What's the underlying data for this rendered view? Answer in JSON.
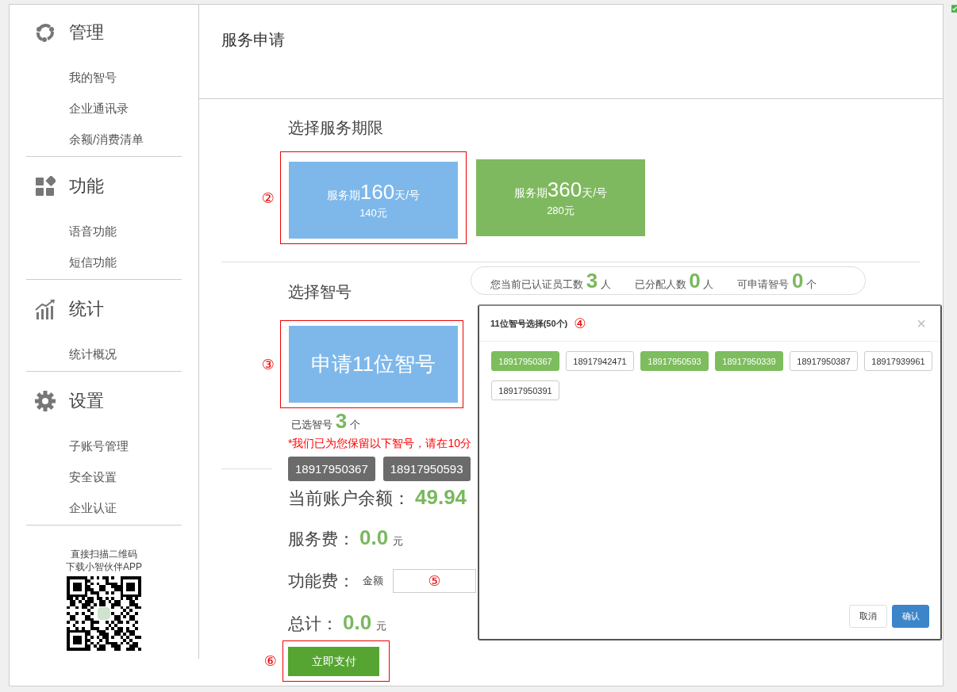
{
  "sidebar": {
    "groups": [
      {
        "kind": "cycle",
        "title": "管理",
        "items": [
          "我的智号",
          "企业通讯录",
          "余额/消费清单"
        ]
      },
      {
        "kind": "blocks",
        "title": "功能",
        "items": [
          "语音功能",
          "短信功能"
        ]
      },
      {
        "kind": "chart",
        "title": "统计",
        "items": [
          "统计概况"
        ]
      },
      {
        "kind": "gear",
        "title": "设置",
        "items": [
          "子账号管理",
          "安全设置",
          "企业认证"
        ]
      }
    ],
    "qr_caption": [
      "直接扫描二维码",
      "下载小智伙伴APP"
    ]
  },
  "main": {
    "title": "服务申请",
    "period_section": {
      "heading": "选择服务期限",
      "options": [
        {
          "prefix": "服务期",
          "days": "160",
          "unit": "天/号",
          "price": "140元",
          "selected": true,
          "annotation": "②"
        },
        {
          "prefix": "服务期",
          "days": "360",
          "unit": "天/号",
          "price": "280元",
          "selected": false
        }
      ]
    },
    "number_section": {
      "heading": "选择智号",
      "stats": [
        {
          "label": "您当前已认证员工数",
          "value": "3",
          "unit": "人"
        },
        {
          "label": "已分配人数",
          "value": "0",
          "unit": "人"
        },
        {
          "label": "可申请智号",
          "value": "0",
          "unit": "个"
        }
      ],
      "apply_button": {
        "label": "申请11位智号",
        "annotation": "③"
      },
      "selected_count": {
        "label": "已选智号",
        "value": "3",
        "unit": "个"
      },
      "notice": "*我们已为您保留以下智号，请在10分",
      "chosen_numbers": [
        "18917950367",
        "18917950593"
      ]
    },
    "balance": {
      "label": "当前账户余额：",
      "value": "49.94"
    },
    "service_fee": {
      "label": "服务费：",
      "value": "0.0",
      "unit": "元"
    },
    "function_fee": {
      "label": "功能费：",
      "sub_label": "金额",
      "annotation": "⑤"
    },
    "total": {
      "label": "总计：",
      "value": "0.0",
      "unit": "元"
    },
    "pay_button": {
      "label": "立即支付",
      "annotation": "⑥"
    }
  },
  "modal": {
    "title": "11位智号选择(50个)",
    "annotation": "④",
    "close": "×",
    "numbers": [
      {
        "number": "18917950367",
        "selected": true
      },
      {
        "number": "18917942471",
        "selected": false
      },
      {
        "number": "18917950593",
        "selected": true
      },
      {
        "number": "18917950339",
        "selected": true
      },
      {
        "number": "18917950387",
        "selected": false
      },
      {
        "number": "18917939961",
        "selected": false
      },
      {
        "number": "18917950391",
        "selected": false
      }
    ],
    "buttons": [
      {
        "label": "取消",
        "kind": "default"
      },
      {
        "label": "确认",
        "kind": "primary"
      }
    ]
  }
}
